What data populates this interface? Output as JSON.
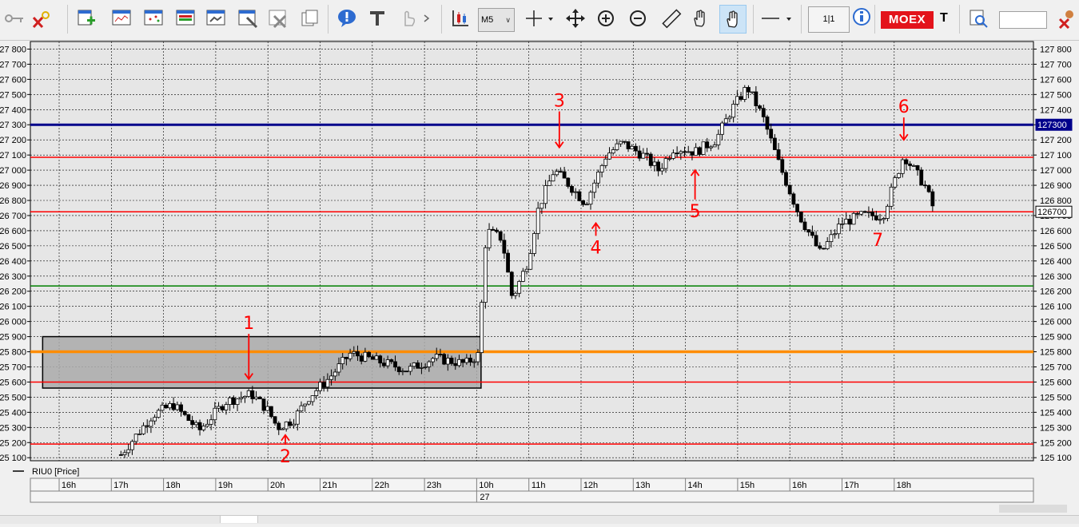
{
  "toolbar": {
    "timeframe": "M5",
    "scale_label": "1|1",
    "exchange_badge": "MOEX",
    "ticker_short": "T"
  },
  "colors": {
    "plot_bg": "#e6e6e6",
    "candle": "#000000",
    "level_red": "#ff0000",
    "level_blue": "#00008b",
    "level_green": "#008000",
    "level_orange": "#ff8c00",
    "zone_fill": "#a9a9a9",
    "annotation": "#ff0000"
  },
  "chart_data": {
    "type": "candlestick",
    "legend": "RIU0 [Price]",
    "ylim": [
      125080,
      127850
    ],
    "y_ticks": [
      125100,
      125200,
      125300,
      125400,
      125500,
      125600,
      125700,
      125800,
      125900,
      126000,
      126100,
      126200,
      126300,
      126400,
      126500,
      126600,
      126700,
      126800,
      126900,
      127000,
      127100,
      127200,
      127300,
      127400,
      127500,
      127600,
      127700,
      127800
    ],
    "x_ticks": [
      "16h",
      "17h",
      "18h",
      "19h",
      "20h",
      "21h",
      "22h",
      "23h",
      "10h",
      "11h",
      "12h",
      "13h",
      "14h",
      "15h",
      "16h",
      "17h",
      "18h"
    ],
    "date_marker": {
      "label": "27",
      "at_tick": 8
    },
    "levels": [
      {
        "value": 127300,
        "color": "#00008b",
        "width": 3,
        "price_tag": "127300"
      },
      {
        "value": 127085,
        "color": "#ff0000",
        "width": 1.5
      },
      {
        "value": 126725,
        "color": "#ff0000",
        "width": 1.5,
        "price_tag": "126700"
      },
      {
        "value": 126235,
        "color": "#008000",
        "width": 1.5
      },
      {
        "value": 125800,
        "color": "#ff8c00",
        "width": 3.5
      },
      {
        "value": 125600,
        "color": "#ff0000",
        "width": 1.5
      },
      {
        "value": 125190,
        "color": "#ff0000",
        "width": 1.5
      }
    ],
    "zone": {
      "x_from": -0.5,
      "x_to": 7.9,
      "y_low": 125560,
      "y_high": 125900
    },
    "anchors": [
      {
        "t": 1.0,
        "p": 125120
      },
      {
        "t": 1.6,
        "p": 125380
      },
      {
        "t": 2.0,
        "p": 125450
      },
      {
        "t": 2.5,
        "p": 125280
      },
      {
        "t": 3.0,
        "p": 125470
      },
      {
        "t": 3.5,
        "p": 125520
      },
      {
        "t": 3.8,
        "p": 125420
      },
      {
        "t": 4.0,
        "p": 125300
      },
      {
        "t": 4.3,
        "p": 125350
      },
      {
        "t": 4.6,
        "p": 125500
      },
      {
        "t": 5.0,
        "p": 125630
      },
      {
        "t": 5.4,
        "p": 125790
      },
      {
        "t": 6.0,
        "p": 125730
      },
      {
        "t": 6.5,
        "p": 125680
      },
      {
        "t": 7.0,
        "p": 125760
      },
      {
        "t": 7.6,
        "p": 125720
      },
      {
        "t": 7.85,
        "p": 125780
      },
      {
        "t": 8.0,
        "p": 126600
      },
      {
        "t": 8.3,
        "p": 126550
      },
      {
        "t": 8.5,
        "p": 126150
      },
      {
        "t": 8.8,
        "p": 126400
      },
      {
        "t": 9.0,
        "p": 126750
      },
      {
        "t": 9.3,
        "p": 127000
      },
      {
        "t": 9.6,
        "p": 126900
      },
      {
        "t": 9.9,
        "p": 126780
      },
      {
        "t": 10.3,
        "p": 127100
      },
      {
        "t": 10.6,
        "p": 127180
      },
      {
        "t": 11.0,
        "p": 127100
      },
      {
        "t": 11.3,
        "p": 127000
      },
      {
        "t": 11.6,
        "p": 127150
      },
      {
        "t": 12.0,
        "p": 127120
      },
      {
        "t": 12.4,
        "p": 127200
      },
      {
        "t": 12.7,
        "p": 127400
      },
      {
        "t": 13.0,
        "p": 127550
      },
      {
        "t": 13.3,
        "p": 127350
      },
      {
        "t": 13.6,
        "p": 127050
      },
      {
        "t": 14.0,
        "p": 126700
      },
      {
        "t": 14.4,
        "p": 126450
      },
      {
        "t": 14.8,
        "p": 126650
      },
      {
        "t": 15.2,
        "p": 126700
      },
      {
        "t": 15.6,
        "p": 126700
      },
      {
        "t": 16.0,
        "p": 127100
      },
      {
        "t": 16.4,
        "p": 126900
      },
      {
        "t": 16.6,
        "p": 126720
      }
    ],
    "annotations": [
      {
        "label": "1",
        "t": 3.45,
        "p": 125950,
        "arrow": "down",
        "arrow_to": 125620
      },
      {
        "label": "2",
        "t": 4.15,
        "p": 125070,
        "arrow": "up",
        "arrow_to": 125250
      },
      {
        "label": "3",
        "t": 9.4,
        "p": 127420,
        "arrow": "down",
        "arrow_to": 127150
      },
      {
        "label": "4",
        "t": 10.1,
        "p": 126450,
        "arrow": "up",
        "arrow_to": 126650
      },
      {
        "label": "5",
        "t": 12.0,
        "p": 126690,
        "arrow": "up",
        "arrow_to": 127000
      },
      {
        "label": "6",
        "t": 16.0,
        "p": 127380,
        "arrow": "down",
        "arrow_to": 127200
      },
      {
        "label": "7",
        "t": 15.5,
        "p": 126500,
        "arrow": "none"
      }
    ]
  }
}
